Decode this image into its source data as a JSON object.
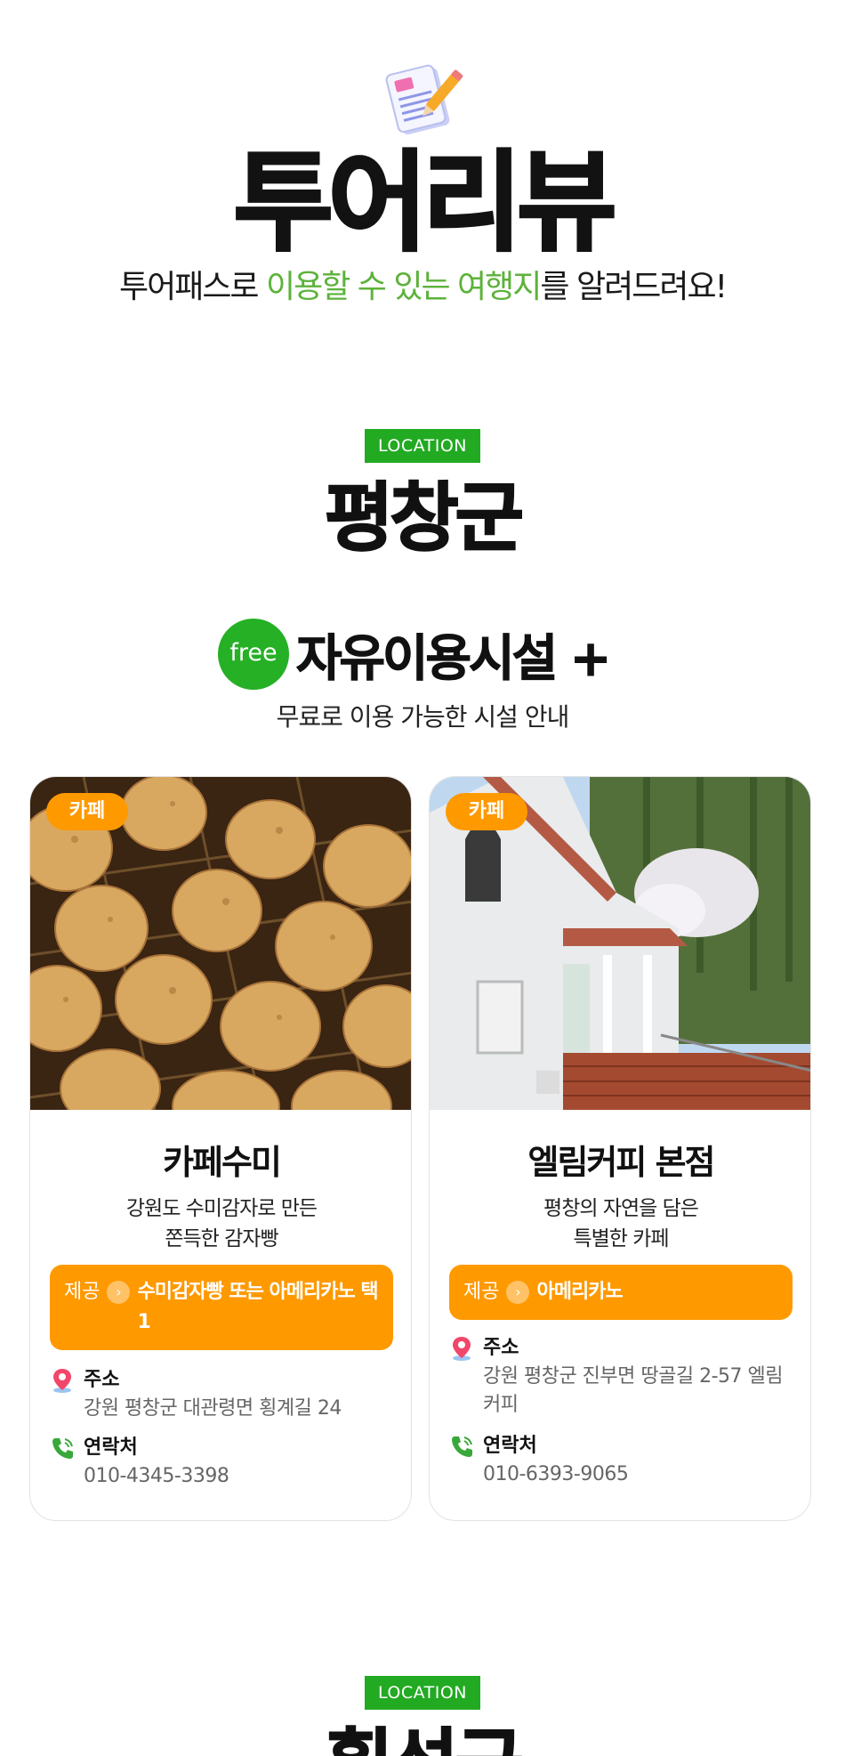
{
  "header": {
    "title": "투어리뷰",
    "subtitle_pre": "투어패스로 ",
    "subtitle_highlight": "이용할 수 있는 여행지",
    "subtitle_post": "를 알려드려요!",
    "icon": "notepad-pencil-icon"
  },
  "sections": [
    {
      "badge": "LOCATION",
      "title": "평창군",
      "free_badge": "free",
      "facility_title": "자유이용시설 +",
      "facility_desc": "무료로 이용 가능한 시설 안내",
      "cards": [
        {
          "category": "카페",
          "name": "카페수미",
          "desc": "강원도 수미감자로 만든\n쫀득한 감자빵",
          "offer_label": "제공",
          "offer_text": "수미감자빵 또는 아메리카노 택 1",
          "address_label": "주소",
          "address": "강원 평창군 대관령면 횡계길 24",
          "phone_label": "연락처",
          "phone": "010-4345-3398",
          "photo": "potato-bread-photo"
        },
        {
          "category": "카페",
          "name": "엘림커피 본점",
          "desc": "평창의 자연을 담은\n특별한 카페",
          "offer_label": "제공",
          "offer_text": "아메리카노",
          "address_label": "주소",
          "address": "강원 평창군 진부면 땅골길 2-57 엘림커피",
          "phone_label": "연락처",
          "phone": "010-6393-9065",
          "photo": "white-cafe-building-photo"
        }
      ]
    },
    {
      "badge": "LOCATION",
      "title": "횡성군"
    }
  ],
  "colors": {
    "accent_green": "#22aa22",
    "highlight_green": "#5cb23a",
    "orange": "#ff9900"
  }
}
